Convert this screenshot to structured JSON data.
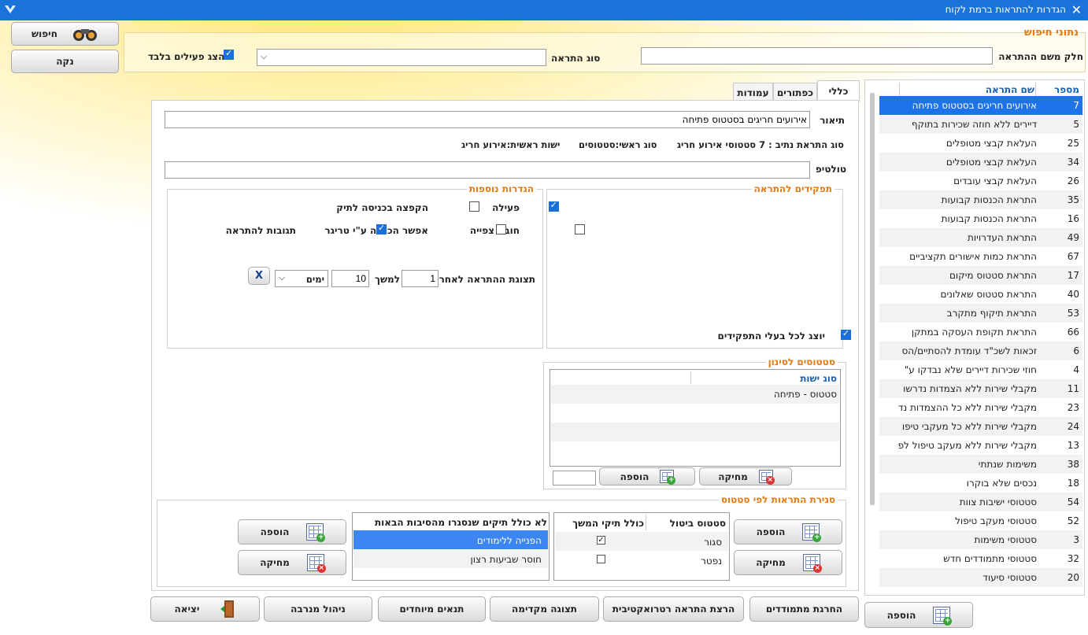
{
  "window": {
    "title": "הגדרות להתראות ברמת לקוח"
  },
  "search": {
    "section_title": "נתוני חיפוש",
    "name_part_label": "חלק משם ההתראה",
    "name_part_value": "",
    "type_label": "סוג התראה",
    "type_value": "",
    "active_only_label": "הצג פעילים בלבד",
    "search_button": "חיפוש",
    "clear_button": "נקה"
  },
  "alerts_list": {
    "col_number": "מספר",
    "col_name": "שם התראה",
    "rows": [
      {
        "num": "7",
        "name": "אירועים חריגים בסטטוס פתיחה"
      },
      {
        "num": "5",
        "name": "דיירים ללא חוזה שכירות בתוקף"
      },
      {
        "num": "25",
        "name": "העלאת קבצי מטופלים"
      },
      {
        "num": "34",
        "name": "העלאת קבצי מטופלים"
      },
      {
        "num": "26",
        "name": "העלאת קבצי עובדים"
      },
      {
        "num": "35",
        "name": "התראת הכנסות קבועות"
      },
      {
        "num": "16",
        "name": "התראת הכנסות קבועות"
      },
      {
        "num": "49",
        "name": "התראת העדרויות"
      },
      {
        "num": "67",
        "name": "התראת כמות אישורים תקציביים"
      },
      {
        "num": "17",
        "name": "התראת סטטוס מיקום"
      },
      {
        "num": "40",
        "name": "התראת סטטוס שאלונים"
      },
      {
        "num": "53",
        "name": "התראת תיקוף מתקרב"
      },
      {
        "num": "66",
        "name": "התראת תקופת העסקה במתקן"
      },
      {
        "num": "6",
        "name": "זכאות לשכ\"ד עומדת להסתיים/הס"
      },
      {
        "num": "4",
        "name": "חוזי שכירות דיירים שלא נבדקו ע\""
      },
      {
        "num": "11",
        "name": "מקבלי שירות ללא הצמדות נדרשו"
      },
      {
        "num": "23",
        "name": "מקבלי שירות ללא כל ההצמדות נד"
      },
      {
        "num": "24",
        "name": "מקבלי שירות ללא כל מעקבי טיפו"
      },
      {
        "num": "13",
        "name": "מקבלי שירות ללא מעקב טיפול לפ"
      },
      {
        "num": "38",
        "name": "משימות שנתתי"
      },
      {
        "num": "18",
        "name": "נכסים שלא בוקרו"
      },
      {
        "num": "54",
        "name": "סטטוסי ישיבות צוות"
      },
      {
        "num": "52",
        "name": "סטטוסי מעקב טיפול"
      },
      {
        "num": "3",
        "name": "סטטוסי משימות"
      },
      {
        "num": "32",
        "name": "סטטוסי מתמודדים חדש"
      },
      {
        "num": "20",
        "name": "סטטוסי סיעוד"
      }
    ],
    "add_button": "הוספה"
  },
  "tabs": [
    {
      "label": "כללי"
    },
    {
      "label": "כפתורים"
    },
    {
      "label": "עמודות"
    }
  ],
  "general": {
    "description_label": "תיאור",
    "description_value": "אירועים חריגים בסטטוס פתיחה",
    "info_alert_type": "סוג התראת נתיב : 7 סטטוסי אירוע חריג",
    "info_main_type": "סוג ראשי:סטטוסים",
    "info_main_entity": "ישות ראשית:אירוע חריג",
    "tooltip_label": "טולטיפ",
    "tooltip_value": ""
  },
  "roles": {
    "title": "תפקידים להתראה",
    "show_all_label": "יוצג לכל בעלי התפקידים"
  },
  "extra": {
    "title": "הגדרות נוספות",
    "active_label": "פעילה",
    "popup_label": "הקפצה בכניסה לתיק",
    "must_view_label": "חובת צפייה",
    "trigger_label": "אפשר הכנסה ע\"י טריגר",
    "responses_label": "תגובות להתראה",
    "display_after_label": "תצוגת ההתראה לאחר",
    "display_after_value": "1",
    "for_label": "למשך",
    "for_value": "10",
    "unit_value": "ימים",
    "x_button": "X"
  },
  "statuses_filter": {
    "title": "סטטוסים לסינון",
    "col_entity_type": "סוג ישות",
    "rows": [
      {
        "value": "סטטוס - פתיחה"
      }
    ],
    "delete_button": "מחיקה",
    "add_button": "הוספה"
  },
  "closing": {
    "title": "סגירת התראות לפי סטטוס",
    "col_cancel_status": "סטטוס ביטול",
    "col_include_continue": "כולל תיקי המשך",
    "status_rows": [
      {
        "status": "סגור",
        "include": true
      },
      {
        "status": "נפטר",
        "include": false
      }
    ],
    "add_button": "הוספה",
    "delete_button": "מחיקה",
    "excl_title": "לא כולל תיקים שנסגרו מהסיבות הבאות",
    "excl_rows": [
      {
        "value": "הפנייה ללימודים"
      },
      {
        "value": "חוסר שביעות רצון"
      }
    ],
    "excl_add_button": "הוספה",
    "excl_delete_button": "מחיקה"
  },
  "footer": {
    "exit": "יציאה",
    "subscription": "ניהול מנרבה",
    "special_conditions": "תנאים מיוחדים",
    "preview": "תצוגה מקדימה",
    "retro_run": "הרצת התראה רטרואקטיבית",
    "exclude_participants": "החרגת מתמודדים"
  }
}
